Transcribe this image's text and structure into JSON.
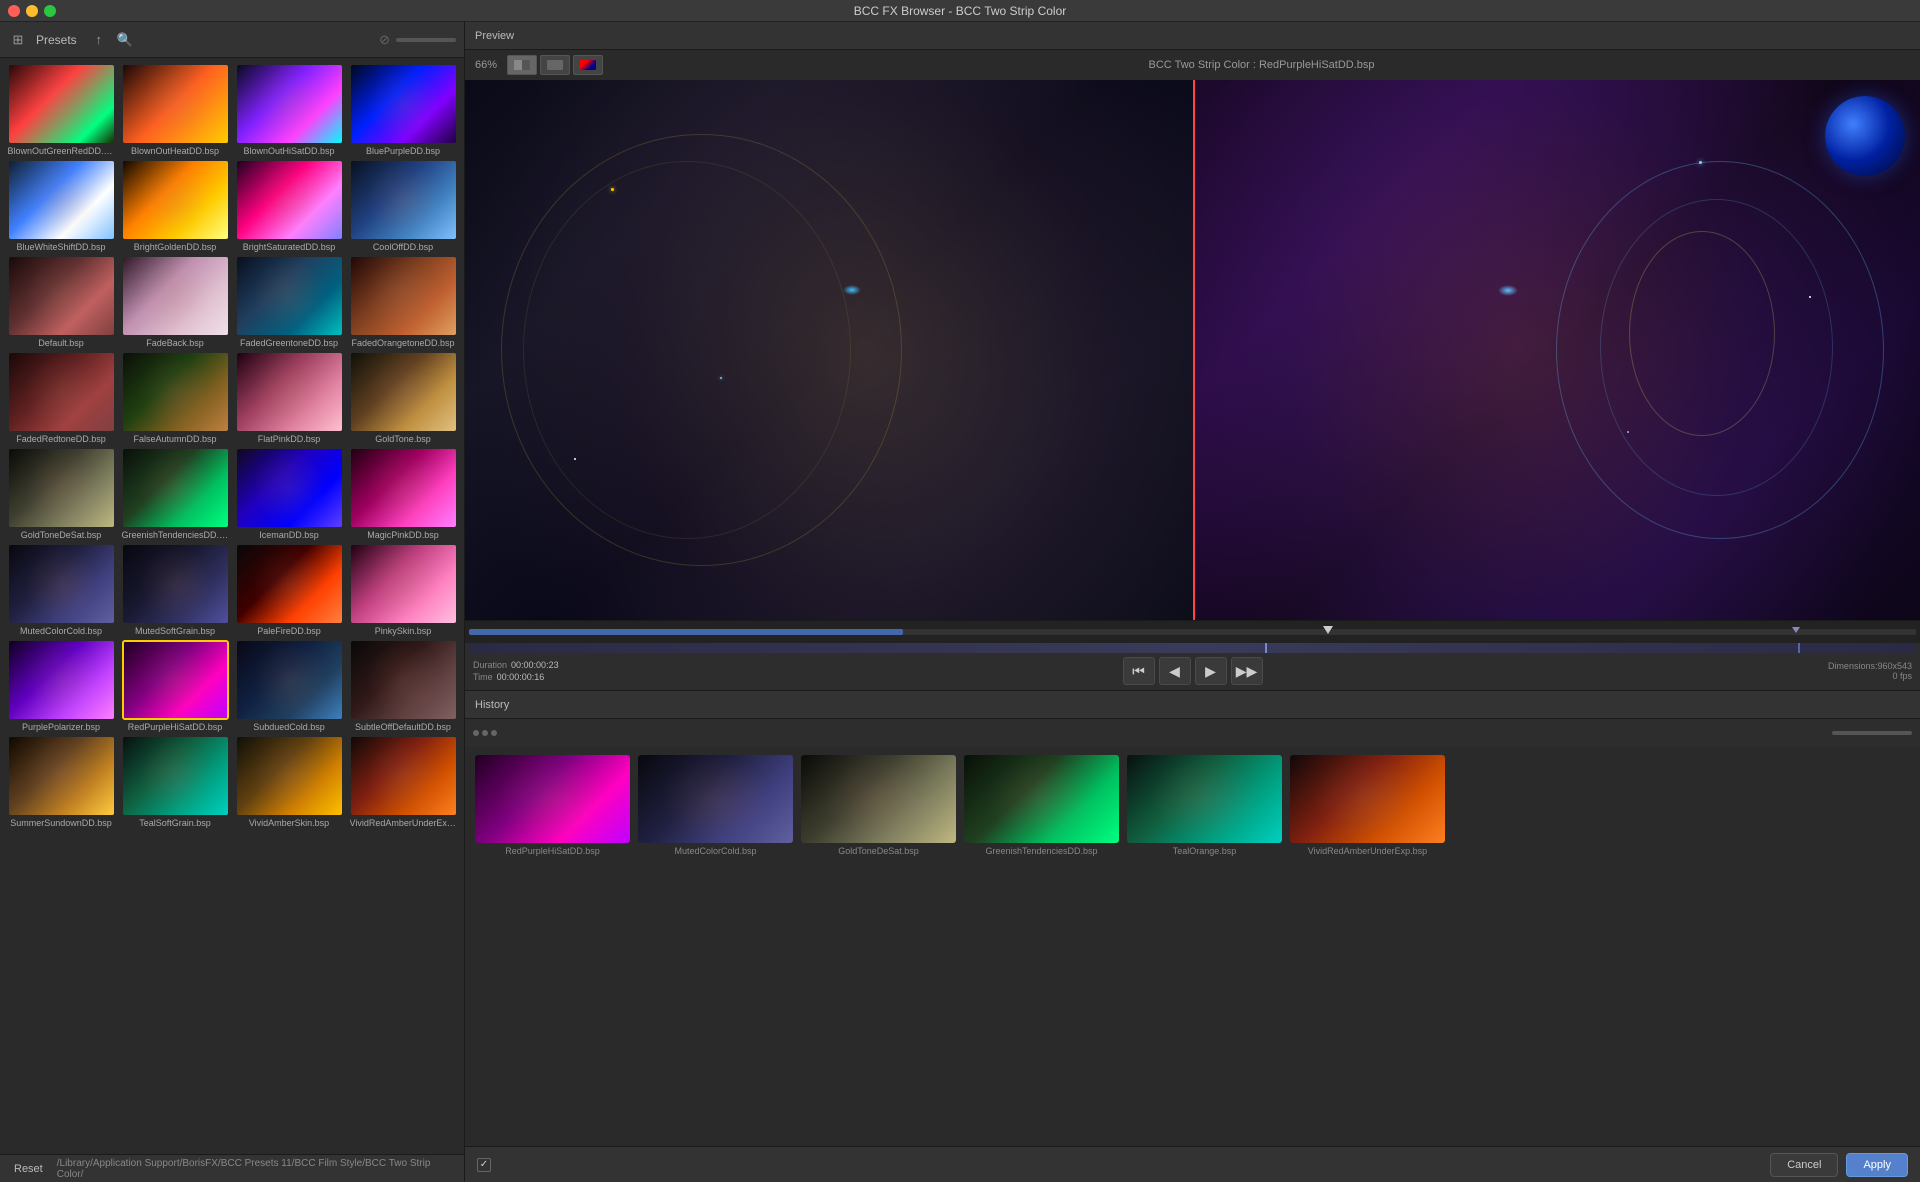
{
  "window": {
    "title": "BCC FX Browser - BCC Two Strip Color"
  },
  "left_panel": {
    "header": {
      "presets_label": "Presets",
      "zoom_slider": ""
    },
    "presets": [
      {
        "name": "BlownOutGreenRedDD.bsp",
        "thumb_class": "thumb-blown-green",
        "selected": false
      },
      {
        "name": "BlownOutHeatDD.bsp",
        "thumb_class": "thumb-blown-heat",
        "selected": false
      },
      {
        "name": "BlownOutHiSatDD.bsp",
        "thumb_class": "thumb-blown-sat",
        "selected": false
      },
      {
        "name": "BluePurpleDD.bsp",
        "thumb_class": "thumb-blue-purple",
        "selected": false
      },
      {
        "name": "BlueWhiteShiftDD.bsp",
        "thumb_class": "thumb-blue-white",
        "selected": false
      },
      {
        "name": "BrightGoldenDD.bsp",
        "thumb_class": "thumb-bright-golden",
        "selected": false
      },
      {
        "name": "BrightSaturatedDD.bsp",
        "thumb_class": "thumb-bright-sat",
        "selected": false
      },
      {
        "name": "CoolOffDD.bsp",
        "thumb_class": "thumb-cool-off",
        "selected": false
      },
      {
        "name": "Default.bsp",
        "thumb_class": "thumb-default",
        "selected": false
      },
      {
        "name": "FadeBack.bsp",
        "thumb_class": "thumb-fade-back",
        "selected": false
      },
      {
        "name": "FadedGreentoneDD.bsp",
        "thumb_class": "thumb-faded-green",
        "selected": false
      },
      {
        "name": "FadedOrangetoneDD.bsp",
        "thumb_class": "thumb-faded-orange",
        "selected": false
      },
      {
        "name": "FadedRedtoneDD.bsp",
        "thumb_class": "thumb-faded-red",
        "selected": false
      },
      {
        "name": "FalseAutumnDD.bsp",
        "thumb_class": "thumb-false-autumn",
        "selected": false
      },
      {
        "name": "FlatPinkDD.bsp",
        "thumb_class": "thumb-flat-pink",
        "selected": false
      },
      {
        "name": "GoldTone.bsp",
        "thumb_class": "thumb-gold-tone",
        "selected": false
      },
      {
        "name": "GoldToneDeSat.bsp",
        "thumb_class": "thumb-goldtone-desat",
        "selected": false
      },
      {
        "name": "GreenishTendenciesDD.bsp",
        "thumb_class": "thumb-greenish",
        "selected": false
      },
      {
        "name": "IcemanDD.bsp",
        "thumb_class": "thumb-iceman",
        "selected": false
      },
      {
        "name": "MagicPinkDD.bsp",
        "thumb_class": "thumb-magic-pink",
        "selected": false
      },
      {
        "name": "MutedColorCold.bsp",
        "thumb_class": "thumb-muted-cold",
        "selected": false
      },
      {
        "name": "MutedSoftGrain.bsp",
        "thumb_class": "thumb-muted-soft",
        "selected": false
      },
      {
        "name": "PaleFireDD.bsp",
        "thumb_class": "thumb-pale-fire",
        "selected": false
      },
      {
        "name": "PinkySkin.bsp",
        "thumb_class": "thumb-pinky",
        "selected": false
      },
      {
        "name": "PurplePolarizer.bsp",
        "thumb_class": "thumb-purple-pol",
        "selected": false
      },
      {
        "name": "RedPurpleHiSatDD.bsp",
        "thumb_class": "thumb-redpurple",
        "selected": true
      },
      {
        "name": "SubduedCold.bsp",
        "thumb_class": "thumb-subdued-cold",
        "selected": false
      },
      {
        "name": "SubtleOffDefaultDD.bsp",
        "thumb_class": "thumb-subtle-off",
        "selected": false
      },
      {
        "name": "SummerSundownDD.bsp",
        "thumb_class": "thumb-summer",
        "selected": false
      },
      {
        "name": "TealSoftGrain.bsp",
        "thumb_class": "thumb-teal",
        "selected": false
      },
      {
        "name": "VividAmberSkin.bsp",
        "thumb_class": "thumb-vivid-amber",
        "selected": false
      },
      {
        "name": "VividRedAmberUnderExp.bsp",
        "thumb_class": "thumb-vivid-red-amber",
        "selected": false
      }
    ],
    "bottom_path": {
      "reset_label": "Reset",
      "path": "/Library/Application Support/BorisFX/BCC Presets 11/BCC Film Style/BCC Two Strip Color/"
    }
  },
  "right_panel": {
    "preview_label": "Preview",
    "zoom": "66%",
    "split_label": "BCC Two Strip Color : RedPurpleHiSatDD.bsp",
    "playback": {
      "duration_label": "Duration",
      "duration_value": "00:00:00:23",
      "time_label": "Time",
      "time_value": "00:00:00:16",
      "dimensions": "Dimensions:960x543",
      "fps": "0 fps"
    },
    "history_label": "History",
    "history_items": [
      {
        "name": "RedPurpleHiSatDD.bsp",
        "thumb_class": "hist-redpurple"
      },
      {
        "name": "MutedColorCold.bsp",
        "thumb_class": "hist-muted-cold"
      },
      {
        "name": "GoldToneDeSat.bsp",
        "thumb_class": "hist-goldtone-desat"
      },
      {
        "name": "GreenishTendenciesDD.bsp",
        "thumb_class": "hist-greenish"
      },
      {
        "name": "TealOrange.bsp",
        "thumb_class": "hist-teal"
      },
      {
        "name": "VividRedAmberUnderExp.bsp",
        "thumb_class": "hist-vivid-red-amber"
      }
    ]
  },
  "actions": {
    "cancel_label": "Cancel",
    "apply_label": "Apply"
  },
  "icons": {
    "grid_icon": "⊞",
    "upload_icon": "↑",
    "search_icon": "🔍",
    "dots_icon": "···",
    "play_pause_icon": "⏸",
    "prev_frame_icon": "⏮",
    "next_frame_icon": "⏭",
    "rewind_icon": "⏪",
    "step_back_icon": "◀",
    "play_icon": "▶",
    "step_forward_icon": "▶▶"
  }
}
